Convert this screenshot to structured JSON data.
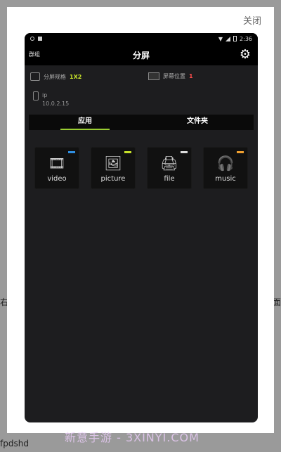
{
  "background": {
    "left_text": "右",
    "right_text": "面",
    "bottom_text": "fpdshd"
  },
  "modal": {
    "close_label": "关闭"
  },
  "statusbar": {
    "time": "2:36"
  },
  "header": {
    "left_label": "群组",
    "title": "分屏"
  },
  "info": {
    "split_spec_label": "分屏规格",
    "split_spec_value": "1X2",
    "screen_position_label": "屏幕位置",
    "screen_position_value": "1",
    "ip_label": "ip",
    "ip_value": "10.0.2.15"
  },
  "tabs": [
    {
      "label": "应用",
      "active": true
    },
    {
      "label": "文件夹",
      "active": false
    }
  ],
  "apps": [
    {
      "label": "video",
      "icon": "film-icon",
      "badge_color": "#2f8ee0"
    },
    {
      "label": "picture",
      "icon": "picture-icon",
      "badge_color": "#c6e02a"
    },
    {
      "label": "file",
      "icon": "printer-icon",
      "badge_color": "#dddddd"
    },
    {
      "label": "music",
      "icon": "headphones-icon",
      "badge_color": "#f0a030"
    }
  ],
  "watermark": "新意手游 - 3XINYI.COM"
}
